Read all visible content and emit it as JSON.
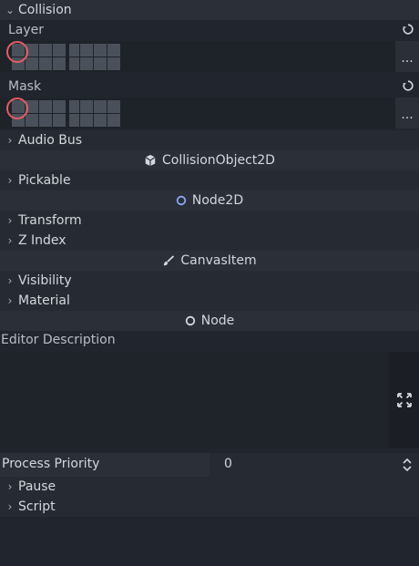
{
  "collision": {
    "header": "Collision",
    "layer_label": "Layer",
    "mask_label": "Mask",
    "more_label": "..."
  },
  "sections": {
    "audio_bus": "Audio Bus",
    "collision_object": "CollisionObject2D",
    "pickable": "Pickable",
    "node2d": "Node2D",
    "transform": "Transform",
    "z_index": "Z Index",
    "canvas_item": "CanvasItem",
    "visibility": "Visibility",
    "material": "Material",
    "node": "Node",
    "editor_description": "Editor Description",
    "pause": "Pause",
    "script": "Script"
  },
  "process_priority": {
    "label": "Process Priority",
    "value": "0"
  },
  "icons": {
    "caret_down": "chevron-down-icon",
    "caret_right": "chevron-right-icon",
    "reset": "reload-icon",
    "cube": "cube-icon",
    "circle": "circle-icon",
    "brush": "brush-icon",
    "expand": "expand-icon",
    "spin": "updown-icon"
  },
  "colors": {
    "background": "#21262e",
    "row": "#2a2f38",
    "highlight": "#e35d62",
    "accent_blue": "#8da5f3"
  }
}
